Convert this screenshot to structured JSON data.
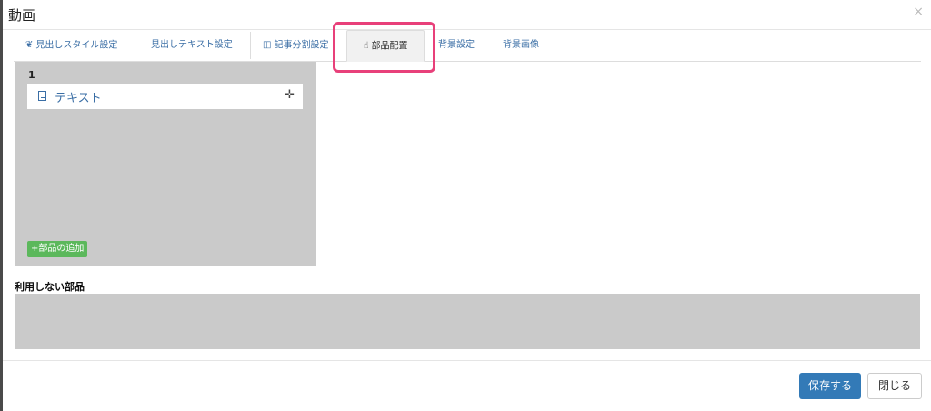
{
  "window": {
    "title": "動画",
    "close_glyph": "×"
  },
  "tabs": [
    {
      "label": "見出しスタイル設定",
      "icon": "leaf-icon",
      "icon_glyph": "❦"
    },
    {
      "label": "見出しテキスト設定"
    },
    {
      "label": "記事分割設定",
      "icon": "columns-icon",
      "icon_glyph": "◫"
    },
    {
      "label": "部品配置",
      "icon": "pointer-hand-icon",
      "icon_glyph": "☝",
      "active": true
    },
    {
      "label": "背景設定"
    },
    {
      "label": "背景画像"
    }
  ],
  "layout_panel": {
    "number": "1",
    "parts": [
      {
        "label": "テキスト",
        "icon": "document-icon",
        "move_glyph": "✛"
      }
    ],
    "add_button": "+部品の追加"
  },
  "unused_parts": {
    "title": "利用しない部品"
  },
  "footer": {
    "save_label": "保存する",
    "close_label": "閉じる"
  },
  "colors": {
    "link": "#3a6ea5",
    "primary": "#337ab7",
    "success": "#5cb85c",
    "panel_bg": "#cacaca",
    "highlight": "#e8407a"
  }
}
